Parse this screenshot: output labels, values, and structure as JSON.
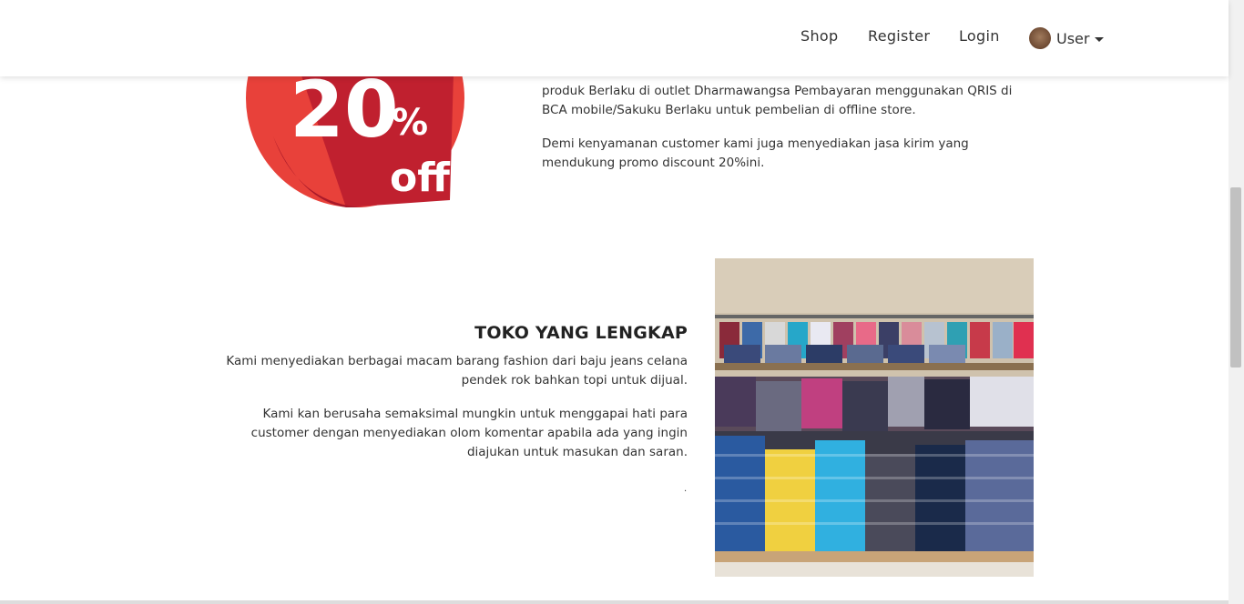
{
  "nav": {
    "shop": "Shop",
    "register": "Register",
    "login": "Login",
    "user": "User"
  },
  "promo": {
    "badge_percent": "20",
    "badge_symbol": "%",
    "badge_off": "off",
    "paragraph1": "produk Berlaku di outlet Dharmawangsa Pembayaran menggunakan QRIS di BCA mobile/Sakuku Berlaku untuk pembelian di offline store.",
    "paragraph2": "Demi kenyamanan customer kami juga menyediakan jasa kirim yang mendukung promo discount 20%ini."
  },
  "store": {
    "title": "TOKO YANG LENGKAP",
    "paragraph1": "Kami menyediakan berbagai macam barang fashion dari baju jeans celana pendek rok bahkan topi untuk dijual.",
    "paragraph2": "Kami kan berusaha semaksimal mungkin untuk menggapai hati para customer dengan menyediakan olom komentar apabila ada yang ingin diajukan untuk masukan dan saran.",
    "dot": "."
  },
  "colors": {
    "badge_red": "#c0202f",
    "badge_light_red": "#e8413a",
    "nav_text": "#333333"
  }
}
